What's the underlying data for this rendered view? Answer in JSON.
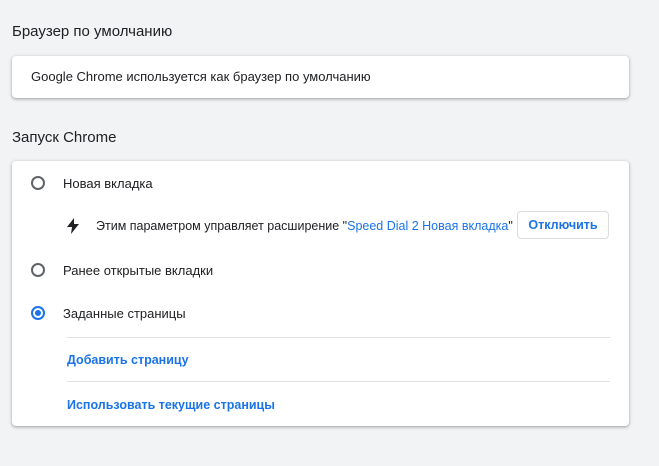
{
  "default_browser": {
    "heading": "Браузер по умолчанию",
    "status_text": "Google Chrome используется как браузер по умолчанию"
  },
  "startup": {
    "heading": "Запуск Chrome",
    "options": [
      {
        "label": "Новая вкладка",
        "selected": false
      },
      {
        "label": "Ранее открытые вкладки",
        "selected": false
      },
      {
        "label": "Заданные страницы",
        "selected": true
      }
    ],
    "extension_notice": {
      "icon": "lightning-bolt-icon",
      "prefix": "Этим параметром управляет расширение \"",
      "extension_name": "Speed Dial 2 Новая вкладка",
      "suffix": "\"",
      "button_label": "Отключить"
    },
    "add_page_label": "Добавить страницу",
    "use_current_label": "Использовать текущие страницы"
  },
  "colors": {
    "accent": "#1a73e8",
    "background": "#f1f3f4",
    "card": "#ffffff",
    "text": "#202124"
  }
}
